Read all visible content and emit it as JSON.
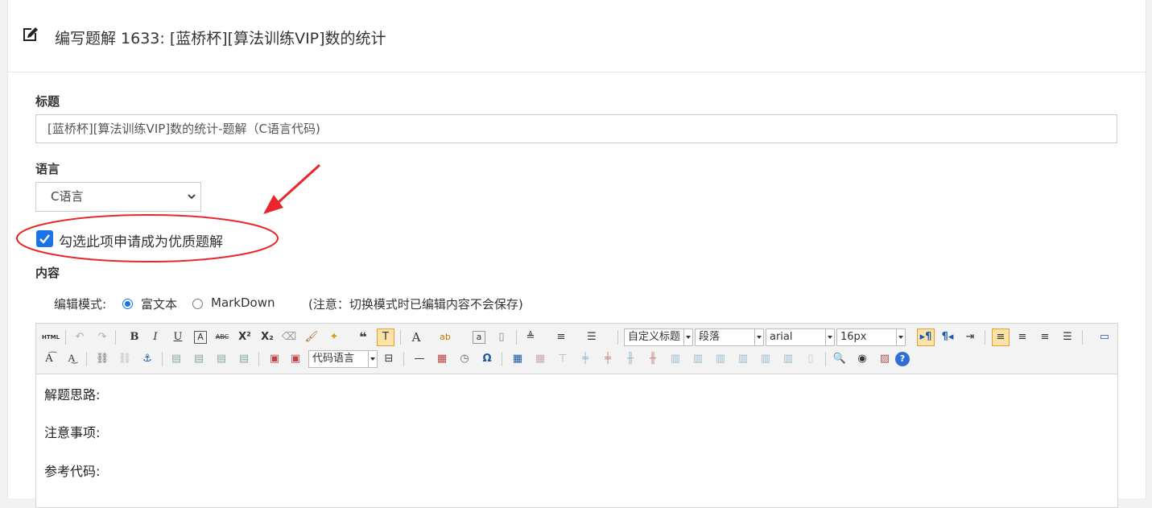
{
  "header": {
    "title": "编写题解 1633: [蓝桥杯][算法训练VIP]数的统计",
    "icon": "edit-icon"
  },
  "form": {
    "title_label": "标题",
    "title_value": "[蓝桥杯][算法训练VIP]数的统计-题解（C语言代码)",
    "language_label": "语言",
    "language_value": "C语言",
    "quality_checkbox_label": "勾选此项申请成为优质题解",
    "quality_checked": true,
    "content_label": "内容"
  },
  "editor_mode": {
    "label": "编辑模式:",
    "options": [
      "富文本",
      "MarkDown"
    ],
    "selected": "富文本",
    "note": "(注意：切换模式时已编辑内容不会保存)"
  },
  "toolbar": {
    "html_label": "HTML",
    "heading_select": "自定义标题",
    "paragraph_select": "段落",
    "font_select": "arial",
    "size_select": "16px",
    "code_lang_select": "代码语言",
    "accent_color": "#1a73e8",
    "annotation_color": "#e8262c"
  },
  "content": {
    "lines": [
      "解题思路:",
      "注意事项:",
      "参考代码:"
    ]
  }
}
